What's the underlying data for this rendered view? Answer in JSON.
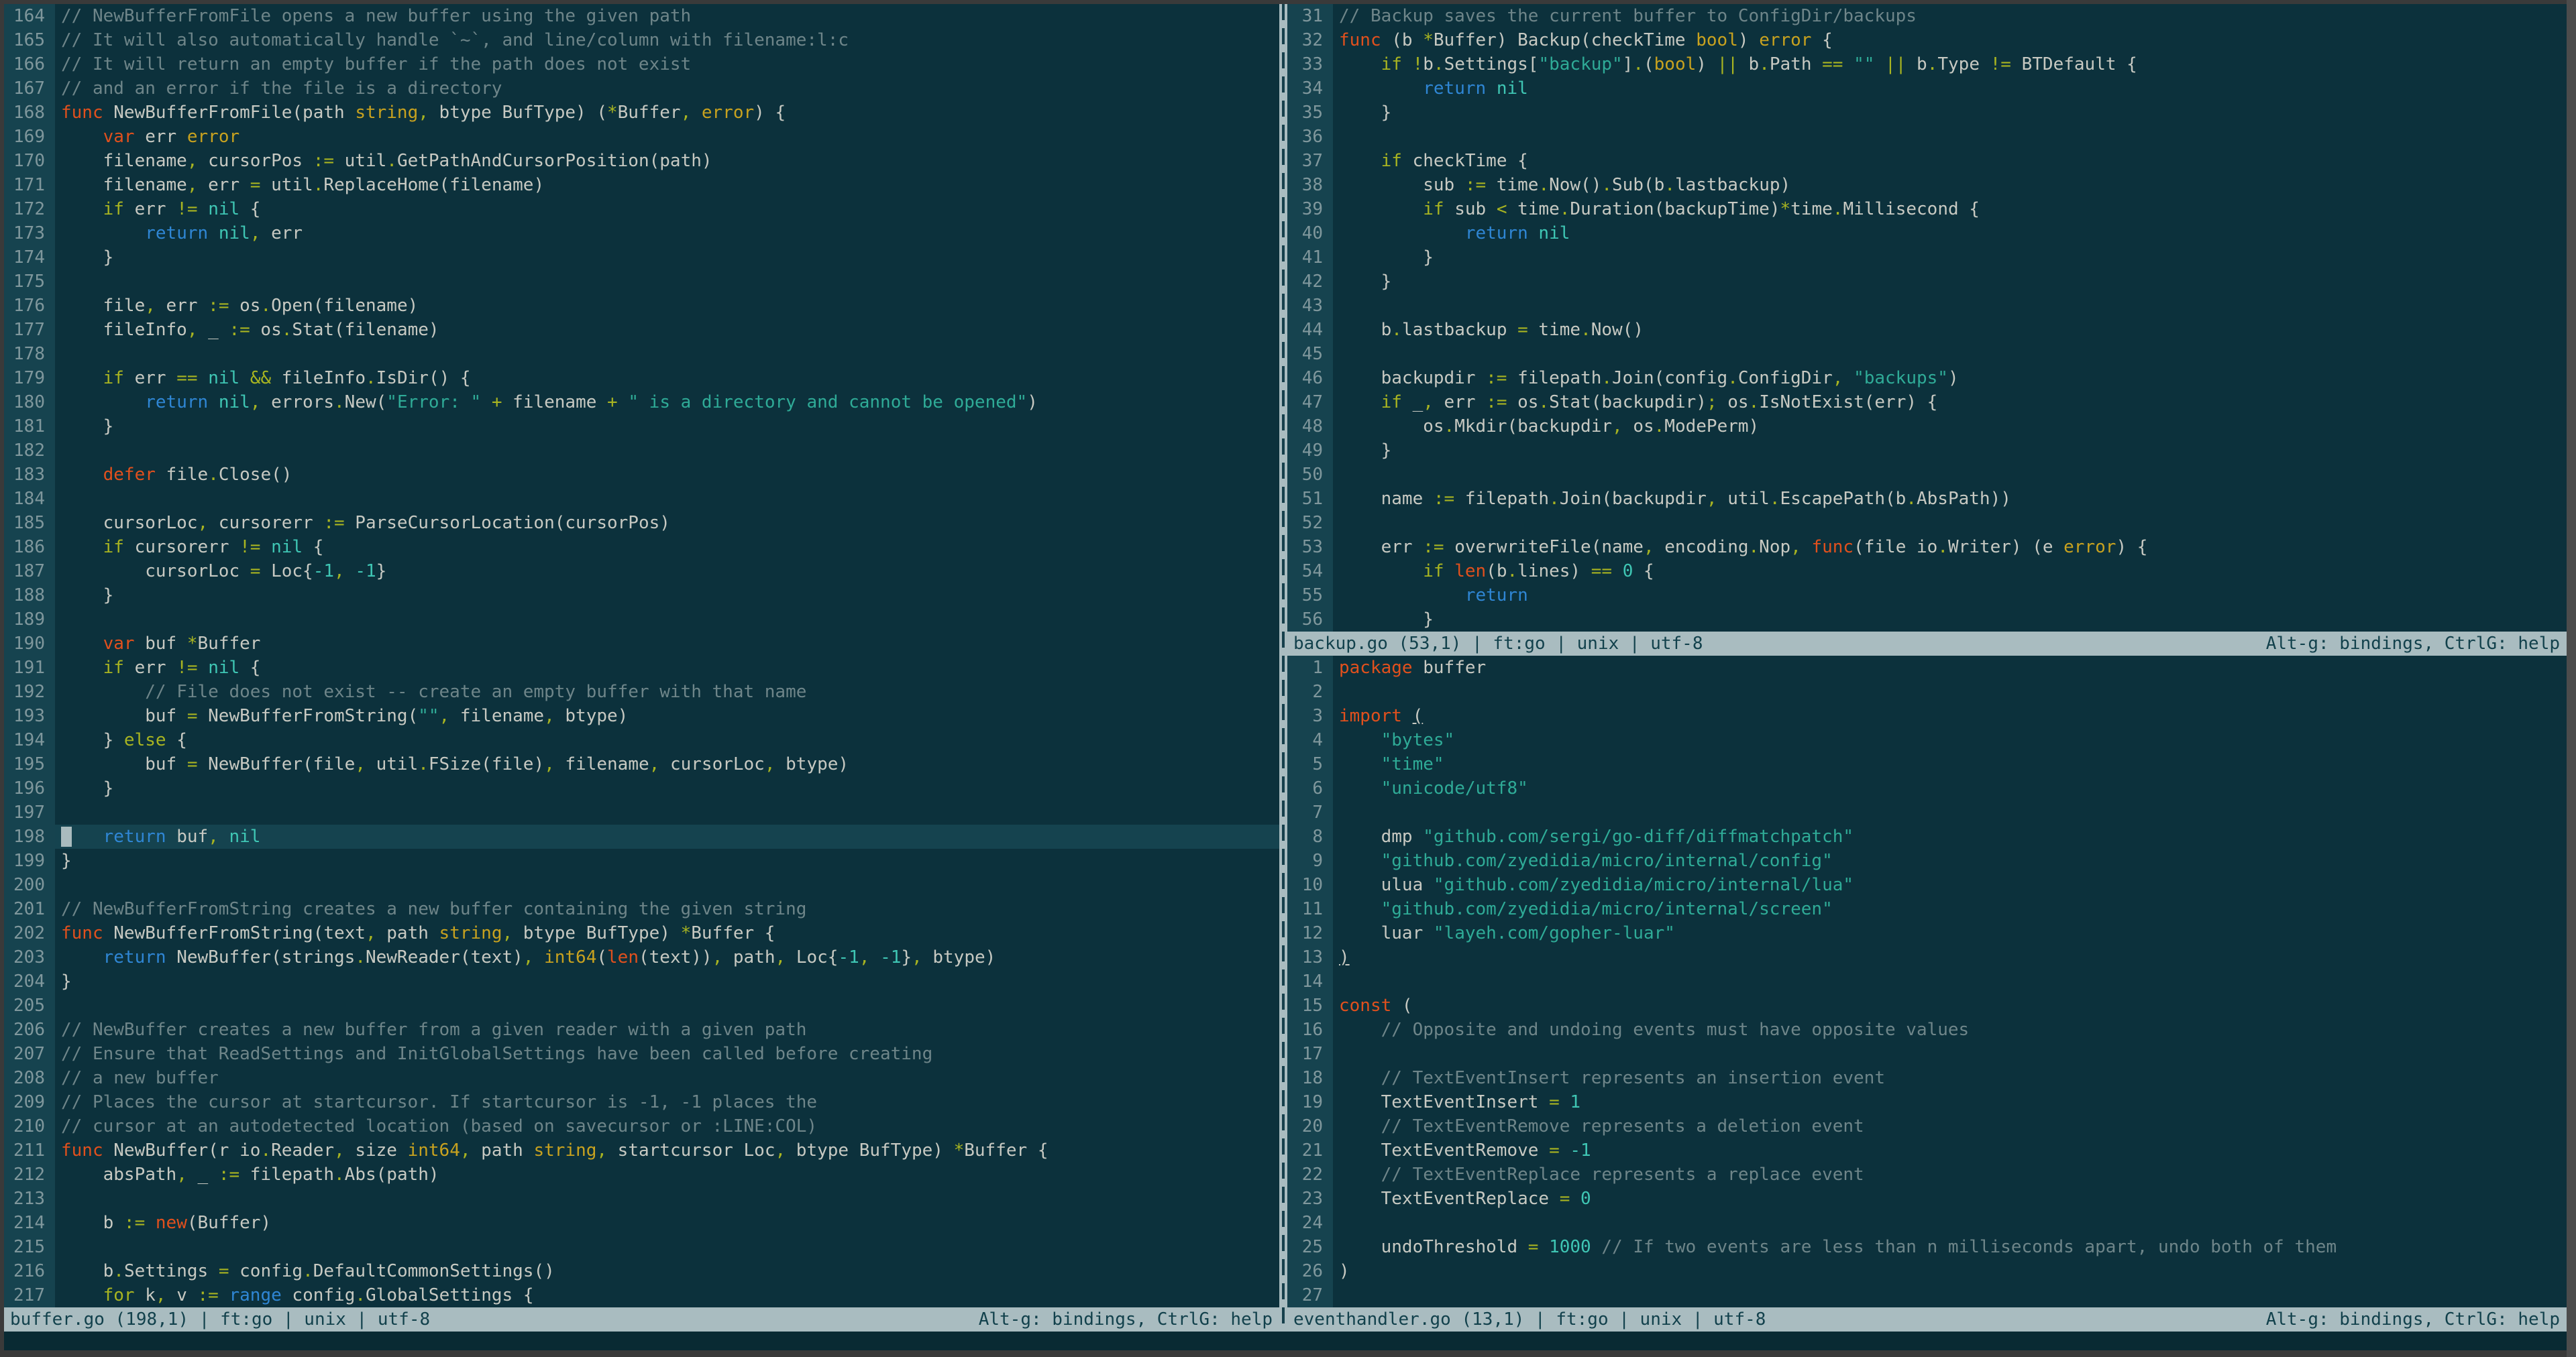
{
  "app": "micro-terminal-editor",
  "colors": {
    "bg": "#0c313c",
    "gutter_bg": "#16434f",
    "gutter_fg": "#7f979c",
    "cursorline_bg": "#15434f",
    "cursor": "#a9bbbe",
    "fg": "#c7c9c2",
    "comment": "#6e8589",
    "kw": "#e1501d",
    "type": "#c8a21f",
    "stmt": "#a8b421",
    "op": "#a8b421",
    "special": "#2f86d4",
    "str": "#2fab97",
    "const": "#3fc6b4",
    "sb_bg": "#a9bcc0",
    "sb_fg": "#12414c",
    "cmd_bg": "#092a33",
    "divider_bg": "#a9bcc0",
    "divider_dash": "#16404c",
    "frame": "#3a3a3a",
    "frame_right": "#4c4c4c"
  },
  "command_line": "",
  "panes": [
    {
      "file": "buffer.go",
      "status_left": "buffer.go (198,1) | ft:go | unix | utf-8",
      "status_right": "Alt-g: bindings, CtrlG: help",
      "lines": [
        {
          "n": 164,
          "t": "// NewBufferFromFile opens a new buffer using the given path"
        },
        {
          "n": 165,
          "t": "// It will also automatically handle `~`, and line/column with filename:l:c"
        },
        {
          "n": 166,
          "t": "// It will return an empty buffer if the path does not exist"
        },
        {
          "n": 167,
          "t": "// and an error if the file is a directory"
        },
        {
          "n": 168,
          "t": "func NewBufferFromFile(path string, btype BufType) (*Buffer, error) {"
        },
        {
          "n": 169,
          "t": "    var err error"
        },
        {
          "n": 170,
          "t": "    filename, cursorPos := util.GetPathAndCursorPosition(path)"
        },
        {
          "n": 171,
          "t": "    filename, err = util.ReplaceHome(filename)"
        },
        {
          "n": 172,
          "t": "    if err != nil {"
        },
        {
          "n": 173,
          "t": "        return nil, err"
        },
        {
          "n": 174,
          "t": "    }"
        },
        {
          "n": 175,
          "t": ""
        },
        {
          "n": 176,
          "t": "    file, err := os.Open(filename)"
        },
        {
          "n": 177,
          "t": "    fileInfo, _ := os.Stat(filename)"
        },
        {
          "n": 178,
          "t": ""
        },
        {
          "n": 179,
          "t": "    if err == nil && fileInfo.IsDir() {"
        },
        {
          "n": 180,
          "t": "        return nil, errors.New(\"Error: \" + filename + \" is a directory and cannot be opened\")"
        },
        {
          "n": 181,
          "t": "    }"
        },
        {
          "n": 182,
          "t": ""
        },
        {
          "n": 183,
          "t": "    defer file.Close()"
        },
        {
          "n": 184,
          "t": ""
        },
        {
          "n": 185,
          "t": "    cursorLoc, cursorerr := ParseCursorLocation(cursorPos)"
        },
        {
          "n": 186,
          "t": "    if cursorerr != nil {"
        },
        {
          "n": 187,
          "t": "        cursorLoc = Loc{-1, -1}"
        },
        {
          "n": 188,
          "t": "    }"
        },
        {
          "n": 189,
          "t": ""
        },
        {
          "n": 190,
          "t": "    var buf *Buffer"
        },
        {
          "n": 191,
          "t": "    if err != nil {"
        },
        {
          "n": 192,
          "t": "        // File does not exist -- create an empty buffer with that name"
        },
        {
          "n": 193,
          "t": "        buf = NewBufferFromString(\"\", filename, btype)"
        },
        {
          "n": 194,
          "t": "    } else {"
        },
        {
          "n": 195,
          "t": "        buf = NewBuffer(file, util.FSize(file), filename, cursorLoc, btype)"
        },
        {
          "n": 196,
          "t": "    }"
        },
        {
          "n": 197,
          "t": ""
        },
        {
          "n": 198,
          "t": "    return buf, nil",
          "cur": true
        },
        {
          "n": 199,
          "t": "}"
        },
        {
          "n": 200,
          "t": ""
        },
        {
          "n": 201,
          "t": "// NewBufferFromString creates a new buffer containing the given string"
        },
        {
          "n": 202,
          "t": "func NewBufferFromString(text, path string, btype BufType) *Buffer {"
        },
        {
          "n": 203,
          "t": "    return NewBuffer(strings.NewReader(text), int64(len(text)), path, Loc{-1, -1}, btype)"
        },
        {
          "n": 204,
          "t": "}"
        },
        {
          "n": 205,
          "t": ""
        },
        {
          "n": 206,
          "t": "// NewBuffer creates a new buffer from a given reader with a given path"
        },
        {
          "n": 207,
          "t": "// Ensure that ReadSettings and InitGlobalSettings have been called before creating"
        },
        {
          "n": 208,
          "t": "// a new buffer"
        },
        {
          "n": 209,
          "t": "// Places the cursor at startcursor. If startcursor is -1, -1 places the"
        },
        {
          "n": 210,
          "t": "// cursor at an autodetected location (based on savecursor or :LINE:COL)"
        },
        {
          "n": 211,
          "t": "func NewBuffer(r io.Reader, size int64, path string, startcursor Loc, btype BufType) *Buffer {"
        },
        {
          "n": 212,
          "t": "    absPath, _ := filepath.Abs(path)"
        },
        {
          "n": 213,
          "t": ""
        },
        {
          "n": 214,
          "t": "    b := new(Buffer)"
        },
        {
          "n": 215,
          "t": ""
        },
        {
          "n": 216,
          "t": "    b.Settings = config.DefaultCommonSettings()"
        },
        {
          "n": 217,
          "t": "    for k, v := range config.GlobalSettings {"
        }
      ]
    },
    {
      "file": "backup.go",
      "status_left": "backup.go (53,1) | ft:go | unix | utf-8",
      "status_right": "Alt-g: bindings, CtrlG: help",
      "lines": [
        {
          "n": 31,
          "t": "// Backup saves the current buffer to ConfigDir/backups"
        },
        {
          "n": 32,
          "t": "func (b *Buffer) Backup(checkTime bool) error {"
        },
        {
          "n": 33,
          "t": "    if !b.Settings[\"backup\"].(bool) || b.Path == \"\" || b.Type != BTDefault {"
        },
        {
          "n": 34,
          "t": "        return nil"
        },
        {
          "n": 35,
          "t": "    }"
        },
        {
          "n": 36,
          "t": ""
        },
        {
          "n": 37,
          "t": "    if checkTime {"
        },
        {
          "n": 38,
          "t": "        sub := time.Now().Sub(b.lastbackup)"
        },
        {
          "n": 39,
          "t": "        if sub < time.Duration(backupTime)*time.Millisecond {"
        },
        {
          "n": 40,
          "t": "            return nil"
        },
        {
          "n": 41,
          "t": "        }"
        },
        {
          "n": 42,
          "t": "    }"
        },
        {
          "n": 43,
          "t": ""
        },
        {
          "n": 44,
          "t": "    b.lastbackup = time.Now()"
        },
        {
          "n": 45,
          "t": ""
        },
        {
          "n": 46,
          "t": "    backupdir := filepath.Join(config.ConfigDir, \"backups\")"
        },
        {
          "n": 47,
          "t": "    if _, err := os.Stat(backupdir); os.IsNotExist(err) {"
        },
        {
          "n": 48,
          "t": "        os.Mkdir(backupdir, os.ModePerm)"
        },
        {
          "n": 49,
          "t": "    }"
        },
        {
          "n": 50,
          "t": ""
        },
        {
          "n": 51,
          "t": "    name := filepath.Join(backupdir, util.EscapePath(b.AbsPath))"
        },
        {
          "n": 52,
          "t": ""
        },
        {
          "n": 53,
          "t": "    err := overwriteFile(name, encoding.Nop, func(file io.Writer) (e error) {"
        },
        {
          "n": 54,
          "t": "        if len(b.lines) == 0 {"
        },
        {
          "n": 55,
          "t": "            return"
        },
        {
          "n": 56,
          "t": "        }"
        }
      ]
    },
    {
      "file": "eventhandler.go",
      "status_left": "eventhandler.go (13,1) | ft:go | unix | utf-8",
      "status_right": "Alt-g: bindings, CtrlG: help",
      "lines": [
        {
          "n": 1,
          "t": "package buffer"
        },
        {
          "n": 2,
          "t": ""
        },
        {
          "n": 3,
          "t": "import (",
          "u": true
        },
        {
          "n": 4,
          "t": "    \"bytes\""
        },
        {
          "n": 5,
          "t": "    \"time\""
        },
        {
          "n": 6,
          "t": "    \"unicode/utf8\""
        },
        {
          "n": 7,
          "t": ""
        },
        {
          "n": 8,
          "t": "    dmp \"github.com/sergi/go-diff/diffmatchpatch\""
        },
        {
          "n": 9,
          "t": "    \"github.com/zyedidia/micro/internal/config\""
        },
        {
          "n": 10,
          "t": "    ulua \"github.com/zyedidia/micro/internal/lua\""
        },
        {
          "n": 11,
          "t": "    \"github.com/zyedidia/micro/internal/screen\""
        },
        {
          "n": 12,
          "t": "    luar \"layeh.com/gopher-luar\""
        },
        {
          "n": 13,
          "t": ")",
          "u": true
        },
        {
          "n": 14,
          "t": ""
        },
        {
          "n": 15,
          "t": "const ("
        },
        {
          "n": 16,
          "t": "    // Opposite and undoing events must have opposite values"
        },
        {
          "n": 17,
          "t": ""
        },
        {
          "n": 18,
          "t": "    // TextEventInsert represents an insertion event"
        },
        {
          "n": 19,
          "t": "    TextEventInsert = 1"
        },
        {
          "n": 20,
          "t": "    // TextEventRemove represents a deletion event"
        },
        {
          "n": 21,
          "t": "    TextEventRemove = -1"
        },
        {
          "n": 22,
          "t": "    // TextEventReplace represents a replace event"
        },
        {
          "n": 23,
          "t": "    TextEventReplace = 0"
        },
        {
          "n": 24,
          "t": ""
        },
        {
          "n": 25,
          "t": "    undoThreshold = 1000 // If two events are less than n milliseconds apart, undo both of them"
        },
        {
          "n": 26,
          "t": ")"
        },
        {
          "n": 27,
          "t": ""
        }
      ]
    }
  ]
}
